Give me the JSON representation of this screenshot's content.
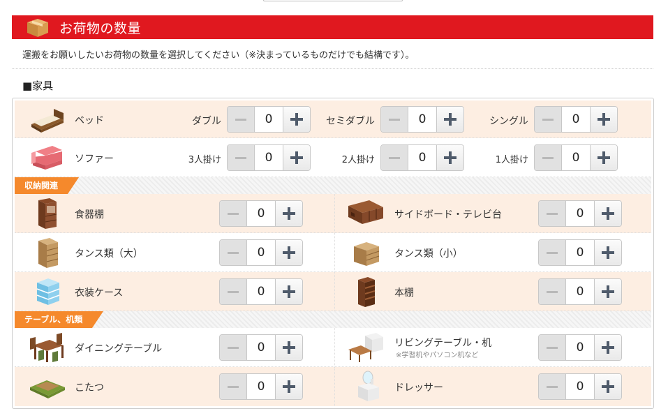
{
  "header": {
    "title": "お荷物の数量",
    "icon": "cardboard-box-icon",
    "bg_color": "#e0181f"
  },
  "intro": "運搬をお願いしたいお荷物の数量を選択してください（※決まっているものだけでも結構です）。",
  "section": {
    "title": "■家具"
  },
  "categories": {
    "storage": "収納関連",
    "tables": "テーブル、机類",
    "accent_color": "#f5892c"
  },
  "items": {
    "bed": {
      "label": "ベッド",
      "icon": "bed-icon",
      "options": [
        {
          "label": "ダブル",
          "value": "0"
        },
        {
          "label": "セミダブル",
          "value": "0"
        },
        {
          "label": "シングル",
          "value": "0"
        }
      ]
    },
    "sofa": {
      "label": "ソファー",
      "icon": "sofa-icon",
      "options": [
        {
          "label": "3人掛け",
          "value": "0"
        },
        {
          "label": "2人掛け",
          "value": "0"
        },
        {
          "label": "1人掛け",
          "value": "0"
        }
      ]
    },
    "cupboard": {
      "label": "食器棚",
      "icon": "cupboard-icon",
      "value": "0"
    },
    "sideboard": {
      "label": "サイドボード・テレビ台",
      "icon": "sideboard-icon",
      "value": "0"
    },
    "chest_large": {
      "label": "タンス類（大）",
      "icon": "chest-large-icon",
      "value": "0"
    },
    "chest_small": {
      "label": "タンス類（小）",
      "icon": "chest-small-icon",
      "value": "0"
    },
    "clothes_case": {
      "label": "衣装ケース",
      "icon": "clothes-case-icon",
      "value": "0"
    },
    "bookshelf": {
      "label": "本棚",
      "icon": "bookshelf-icon",
      "value": "0"
    },
    "dining_table": {
      "label": "ダイニングテーブル",
      "icon": "dining-table-icon",
      "value": "0"
    },
    "living_table": {
      "label": "リビングテーブル・机",
      "note": "※学習机やパソコン机など",
      "icon": "living-table-icon",
      "value": "0"
    },
    "kotatsu": {
      "label": "こたつ",
      "icon": "kotatsu-icon",
      "value": "0"
    },
    "dresser": {
      "label": "ドレッサー",
      "icon": "dresser-icon",
      "value": "0"
    }
  }
}
